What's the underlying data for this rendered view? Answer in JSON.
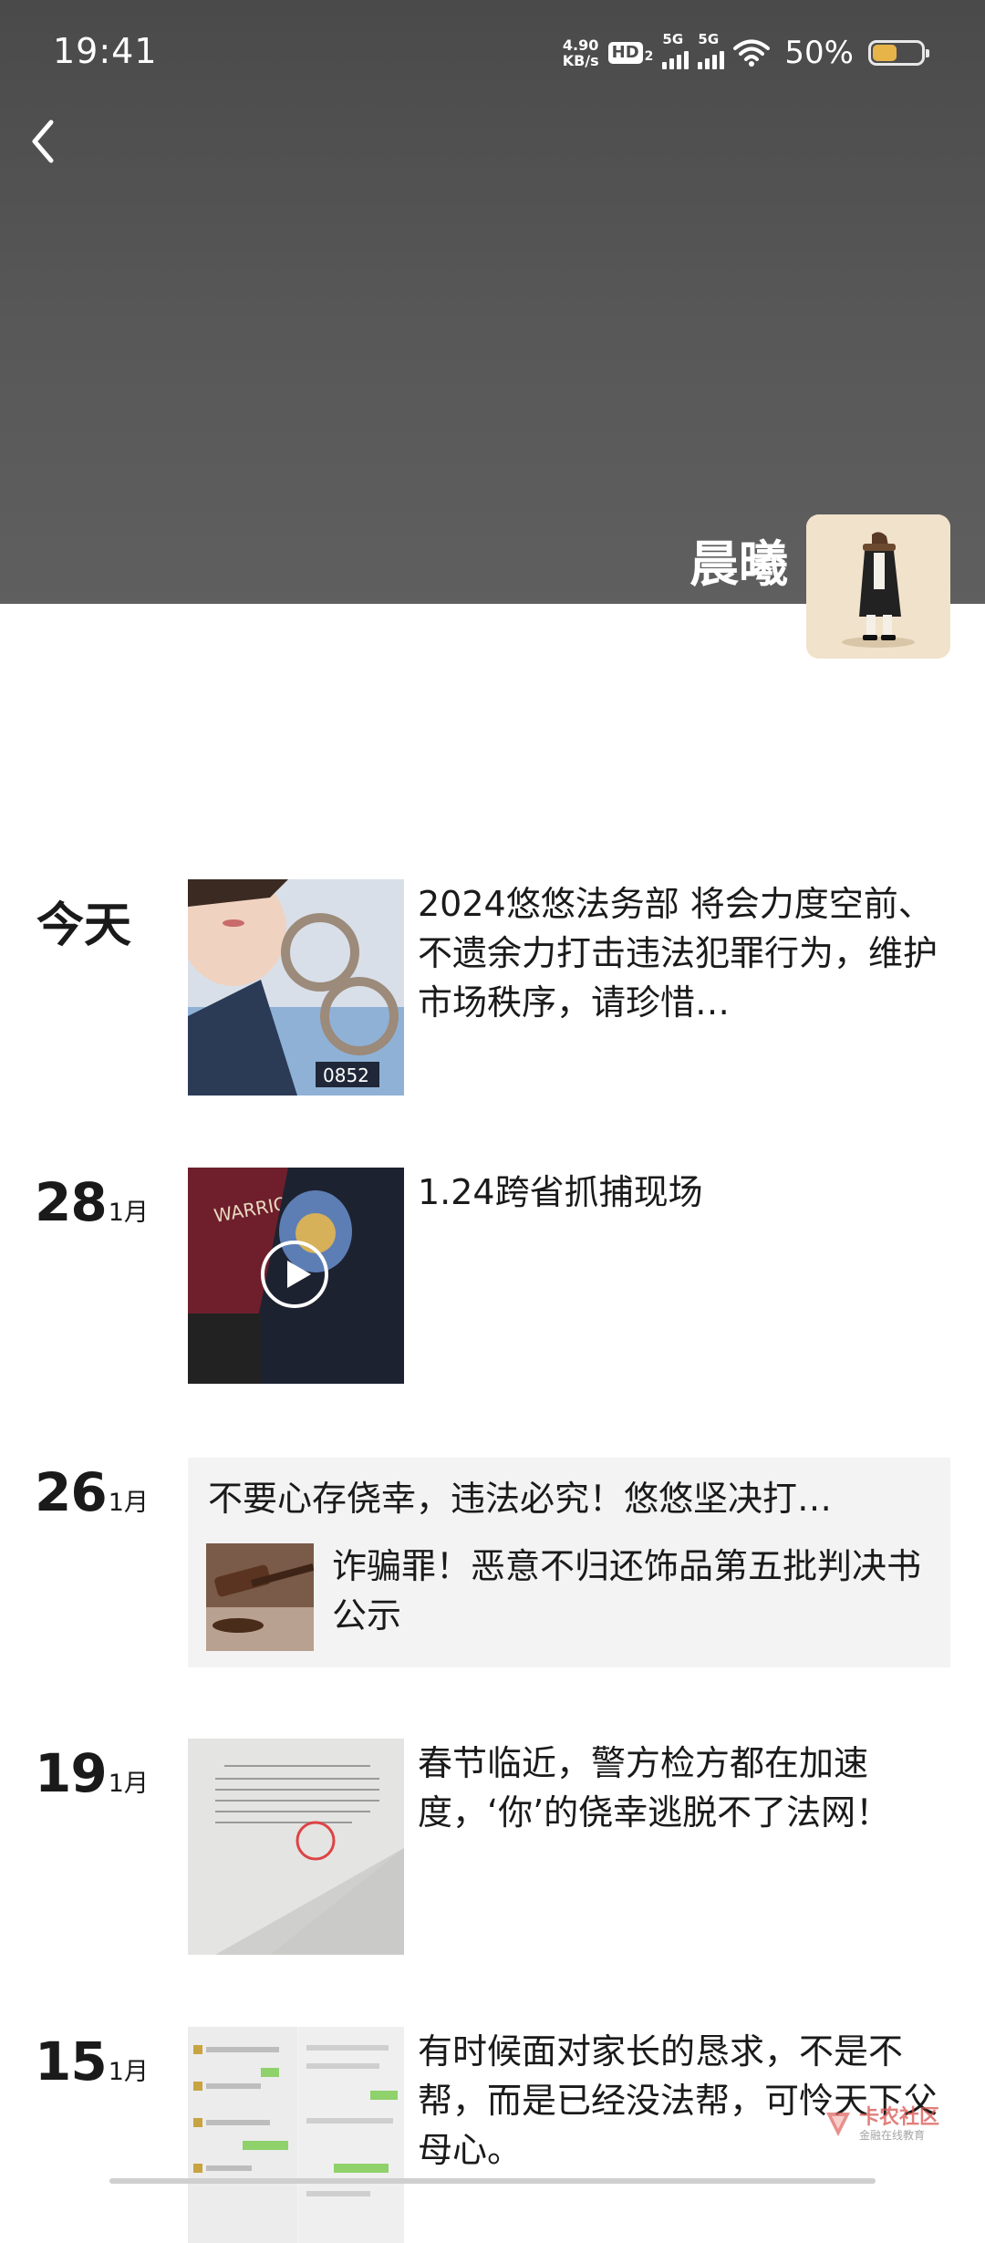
{
  "status_bar": {
    "time": "19:41",
    "net_speed_value": "4.90",
    "net_speed_unit": "KB/s",
    "hd_label": "HD",
    "hd_sub": "2",
    "signal_1_label": "5G",
    "signal_2_label": "5G",
    "battery_percent": "50%",
    "battery_level": 0.5,
    "battery_color": "#e7b44a"
  },
  "header": {
    "back_icon": "chevron-left-icon",
    "profile_name": "晨曦"
  },
  "posts": [
    {
      "date_label": "今天",
      "text": "2024悠悠法务部 将会力度空前、不遗余力打击违法犯罪行为，维护市场秩序，请珍惜…"
    },
    {
      "day": "28",
      "month": "1月",
      "text": "1.24跨省抓捕现场",
      "media": "video"
    },
    {
      "day": "26",
      "month": "1月",
      "share_title": "不要心存侥幸，违法必究！悠悠坚决打…",
      "share_desc": "诈骗罪！恶意不归还饰品第五批判决书公示"
    },
    {
      "day": "19",
      "month": "1月",
      "text": "春节临近，警方检方都在加速度，‘你’的侥幸逃脱不了法网！"
    },
    {
      "day": "15",
      "month": "1月",
      "text": "有时候面对家长的恳求，不是不帮，而是已经没法帮，可怜天下父母心。"
    }
  ],
  "watermark": {
    "main": "卡农社区",
    "sub": "金融在线教育"
  }
}
